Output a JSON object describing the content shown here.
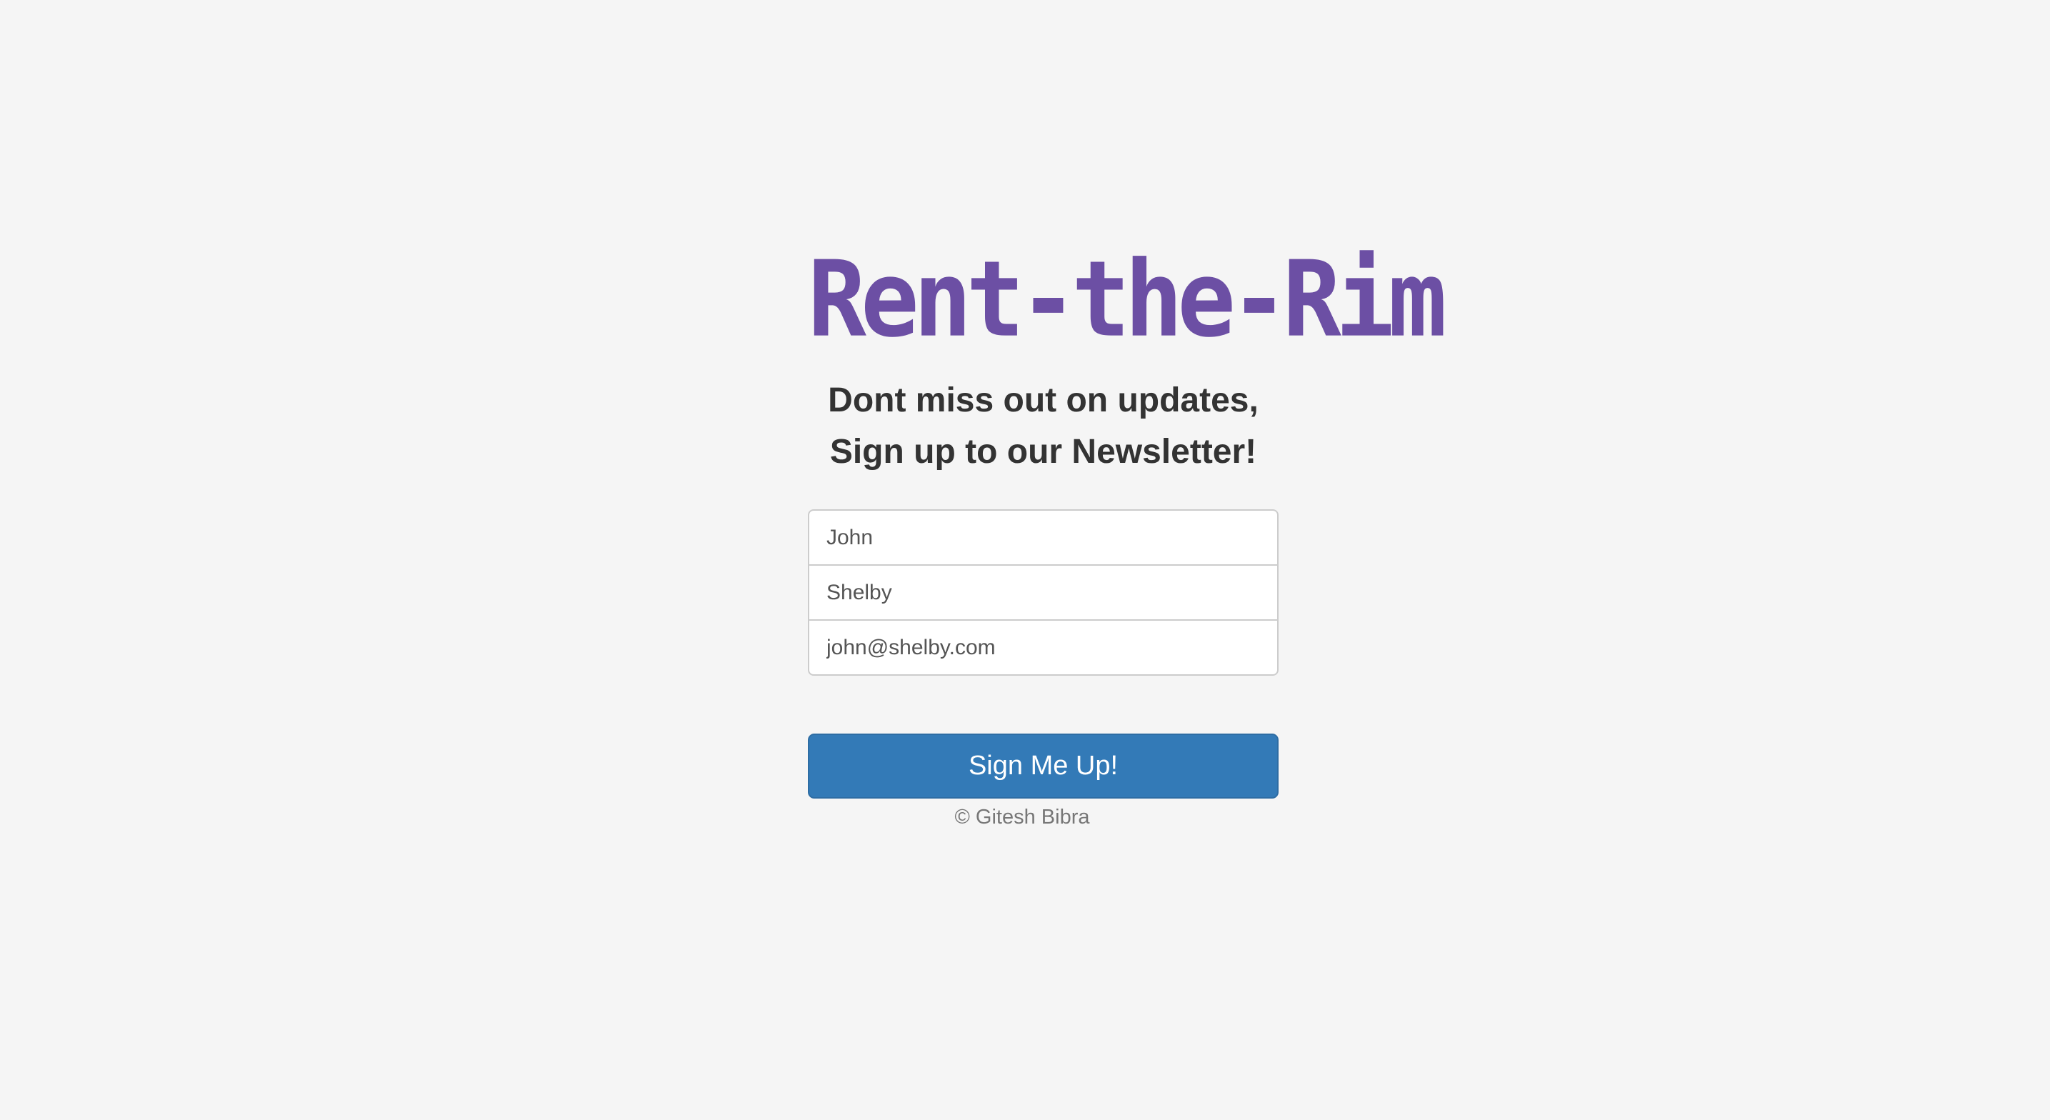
{
  "logo": {
    "text": "Rent-the-Rim",
    "color": "#6c4fa4"
  },
  "heading": {
    "line1": "Dont miss out on updates,",
    "line2": "Sign up to our Newsletter!"
  },
  "form": {
    "first_name": "John",
    "last_name": "Shelby",
    "email": "john@shelby.com"
  },
  "button": {
    "label": "Sign Me Up!",
    "color": "#337ab7"
  },
  "footer": {
    "text": "© Gitesh Bibra"
  }
}
